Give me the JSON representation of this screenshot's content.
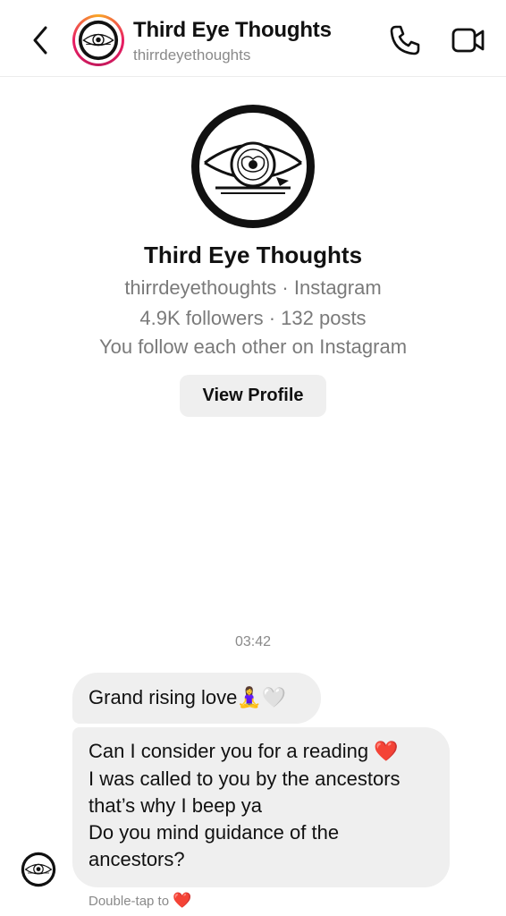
{
  "header": {
    "name": "Third Eye Thoughts",
    "handle": "thirrdeyethoughts"
  },
  "profile": {
    "name": "Third Eye Thoughts",
    "line1": "thirrdeyethoughts · Instagram",
    "line2": "4.9K followers · 132 posts",
    "line3": "You follow each other on Instagram",
    "view_profile_label": "View Profile"
  },
  "chat": {
    "timestamp": "03:42",
    "messages": [
      {
        "text": "Grand rising love",
        "emojis": [
          "🧘‍♀️",
          "🤍"
        ]
      },
      {
        "lines": [
          "Can I consider you for a reading",
          "I was  called to you by the ancestors",
          "that’s why I beep ya",
          "Do you mind guidance of the",
          "ancestors?"
        ],
        "emoji": "❤️"
      }
    ],
    "double_tap_label": "Double-tap to",
    "double_tap_emoji": "❤️"
  },
  "icons": {
    "back": "chevron-left-icon",
    "call": "phone-icon",
    "video": "video-camera-icon",
    "avatar": "third-eye-logo"
  },
  "colors": {
    "bubble": "#efefef",
    "muted_text": "#8a8a8a",
    "heart": "#e0262f",
    "story_ring_start": "#f9a825",
    "story_ring_end": "#e91e63"
  }
}
